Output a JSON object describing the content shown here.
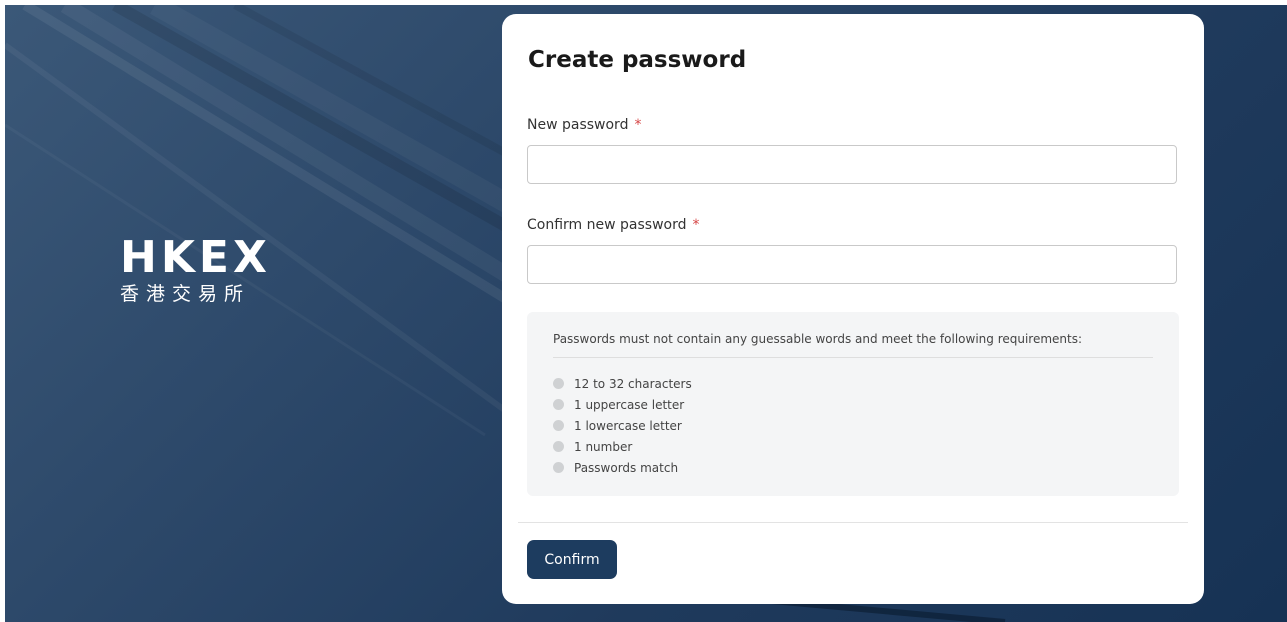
{
  "brand": {
    "logo_text": "HKEX",
    "logo_subtext": "香港交易所"
  },
  "form": {
    "title": "Create password",
    "new_password": {
      "label": "New password",
      "required_mark": "*",
      "value": "",
      "placeholder": ""
    },
    "confirm_password": {
      "label": "Confirm new password",
      "required_mark": "*",
      "value": "",
      "placeholder": ""
    },
    "requirements": {
      "intro": "Passwords must not contain any guessable words and meet the following requirements:",
      "items": [
        {
          "text": "12 to 32 characters",
          "met": false
        },
        {
          "text": "1 uppercase letter",
          "met": false
        },
        {
          "text": "1 lowercase letter",
          "met": false
        },
        {
          "text": "1 number",
          "met": false
        },
        {
          "text": "Passwords match",
          "met": false
        }
      ]
    },
    "confirm_button": "Confirm"
  },
  "colors": {
    "backdrop": "#2e4a6b",
    "button": "#1d3c5f",
    "required": "#d64545",
    "indicator_unmet": "#cfd1d3"
  }
}
